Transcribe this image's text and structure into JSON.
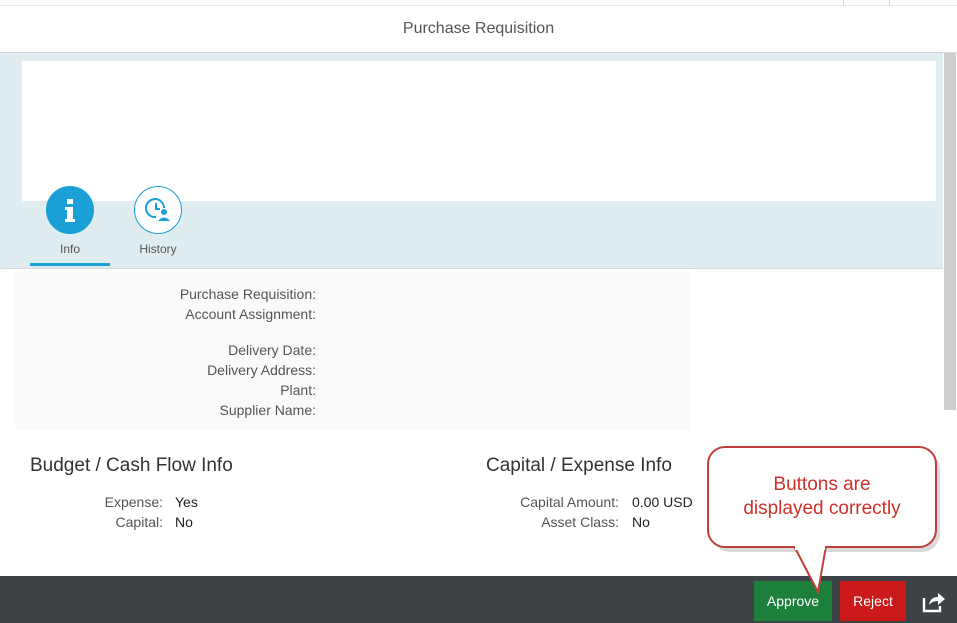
{
  "header": {
    "title": "Purchase Requisition"
  },
  "tabs": [
    {
      "label": "Info",
      "icon": "info-icon",
      "selected": true
    },
    {
      "label": "History",
      "icon": "history-icon",
      "selected": false
    }
  ],
  "details": {
    "purchase_requisition_label": "Purchase Requisition:",
    "account_assignment_label": "Account Assignment:",
    "delivery_date_label": "Delivery Date:",
    "delivery_address_label": "Delivery Address:",
    "plant_label": "Plant:",
    "supplier_name_label": "Supplier Name:"
  },
  "budget": {
    "title": "Budget / Cash Flow Info",
    "expense_label": "Expense:",
    "expense_value": "Yes",
    "capital_label": "Capital:",
    "capital_value": "No"
  },
  "capital": {
    "title": "Capital / Expense Info",
    "amount_label": "Capital Amount:",
    "amount_value": "0.00 USD",
    "asset_class_label": "Asset Class:",
    "asset_class_value": "No"
  },
  "footer": {
    "approve_label": "Approve",
    "reject_label": "Reject",
    "share_icon": "share-icon"
  },
  "annotation": {
    "line1": "Buttons are",
    "line2": "displayed correctly"
  },
  "colors": {
    "accent": "#1a9fd7",
    "approve": "#1d7f3c",
    "reject": "#cc1919",
    "footer_bg": "#3d4247",
    "callout": "#d0302a"
  }
}
